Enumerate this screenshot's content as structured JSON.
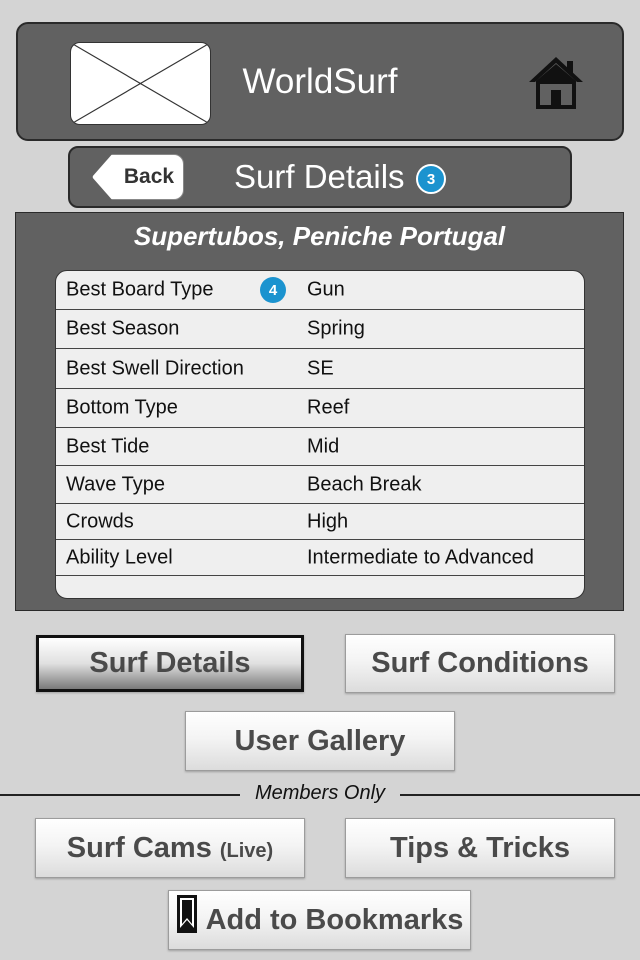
{
  "header": {
    "title": "WorldSurf",
    "logo_icon": "image-placeholder-icon",
    "home_icon": "home-icon"
  },
  "subheader": {
    "back_label": "Back",
    "title": "Surf Details",
    "badge": "3"
  },
  "details": {
    "spot_name": "Supertubos, Peniche Portugal",
    "badge": "4",
    "rows": [
      {
        "label": "Best Board Type",
        "value": "Gun"
      },
      {
        "label": "Best Season",
        "value": "Spring"
      },
      {
        "label": "Best Swell Direction",
        "value": "SE"
      },
      {
        "label": "Bottom Type",
        "value": "Reef"
      },
      {
        "label": "Best Tide",
        "value": "Mid"
      },
      {
        "label": "Wave Type",
        "value": "Beach Break"
      },
      {
        "label": "Crowds",
        "value": "High"
      },
      {
        "label": "Ability Level",
        "value": "Intermediate to Advanced"
      },
      {
        "label": "",
        "value": ""
      }
    ]
  },
  "nav": {
    "surf_details": "Surf Details",
    "surf_conditions": "Surf Conditions",
    "user_gallery": "User Gallery",
    "members_only": "Members Only",
    "surf_cams": "Surf Cams",
    "surf_cams_suffix": "(Live)",
    "tips_tricks": "Tips & Tricks",
    "add_bookmarks": "Add to Bookmarks",
    "bookmark_icon": "bookmark-icon"
  },
  "colors": {
    "panel": "#616161",
    "background": "#d4d4d4",
    "badge": "#1b93cf"
  }
}
